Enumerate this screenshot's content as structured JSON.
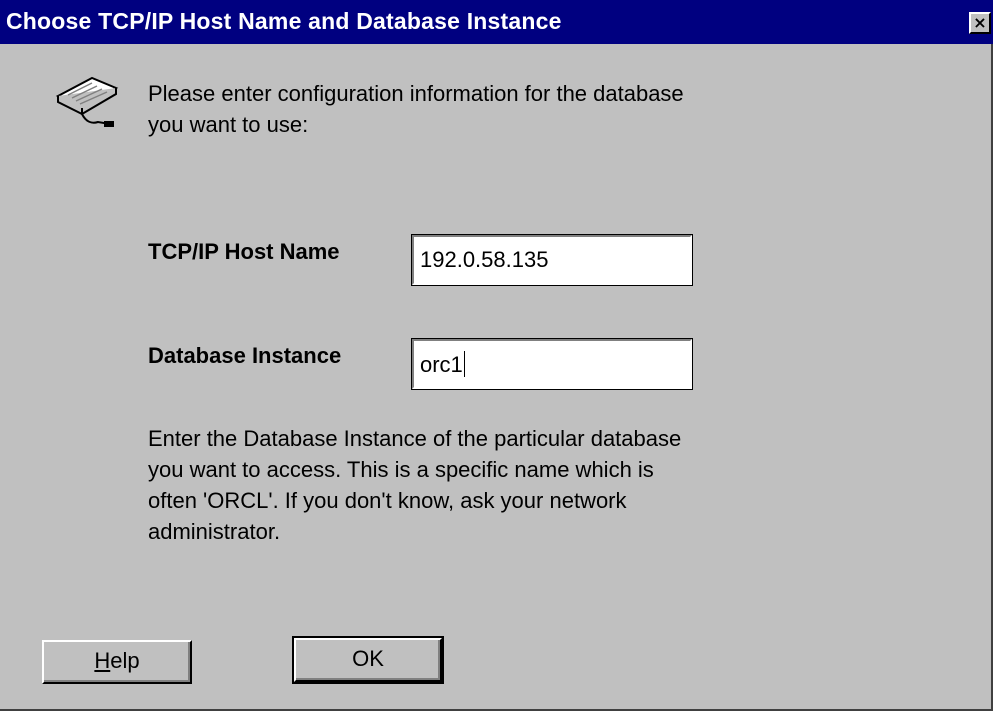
{
  "window": {
    "title": "Choose TCP/IP Host Name and Database Instance",
    "close_symbol": "×",
    "icon": "keyboard-icon"
  },
  "intro_text": "Please enter configuration information for the database you want to use:",
  "fields": {
    "host_name": {
      "label": "TCP/IP Host Name",
      "value": "192.0.58.135"
    },
    "db_instance": {
      "label": "Database Instance",
      "value": "orc1"
    }
  },
  "help_text": "Enter the Database Instance of the particular database you want to access.  This is a specific name which is often 'ORCL'.  If you don't know, ask your network administrator.",
  "buttons": {
    "help_mnemonic": "H",
    "help_rest": "elp",
    "ok": "OK"
  },
  "colors": {
    "titlebar": "#000080",
    "face": "#c0c0c0"
  }
}
